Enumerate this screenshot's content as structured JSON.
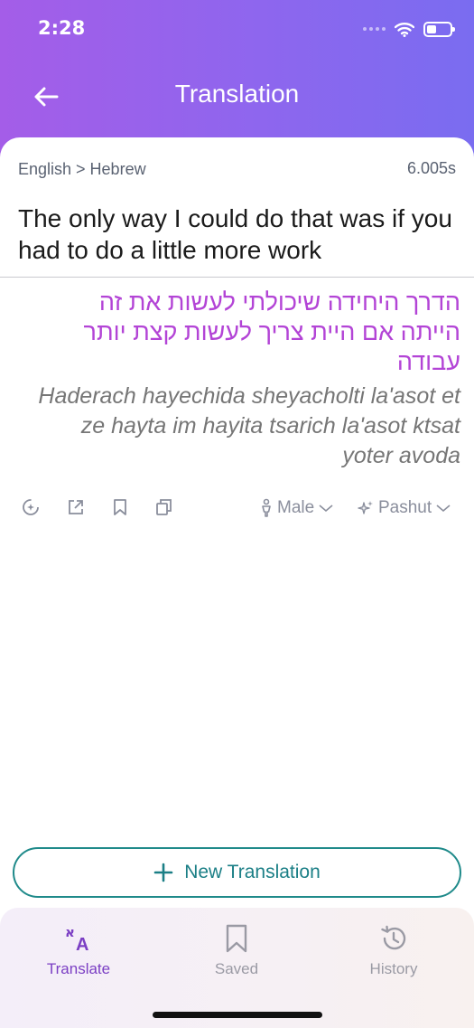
{
  "status": {
    "time": "2:28"
  },
  "header": {
    "title": "Translation"
  },
  "translation": {
    "lang_pair": "English > Hebrew",
    "duration": "6.005s",
    "source": "The only way I could do that was if you had to do a little more work",
    "hebrew": "הדרך היחידה שיכולתי לעשות את זה הייתה אם היית צריך לעשות קצת יותר עבודה",
    "transliteration": "Haderach hayechida sheyacholti la'asot et ze hayta im hayita tsarich la'asot ktsat yoter avoda"
  },
  "options": {
    "gender": "Male",
    "style": "Pashut"
  },
  "new_button": {
    "label": "New Translation"
  },
  "tabs": [
    {
      "label": "Translate",
      "icon": "translate-icon",
      "active": true
    },
    {
      "label": "Saved",
      "icon": "bookmark-icon",
      "active": false
    },
    {
      "label": "History",
      "icon": "history-icon",
      "active": false
    }
  ],
  "colors": {
    "accent": "#8e66ee",
    "hebrew_text": "#b344d6",
    "teal": "#1b7f86",
    "active_tab": "#7b3fc4",
    "inactive_tab": "#9a9aa4"
  }
}
